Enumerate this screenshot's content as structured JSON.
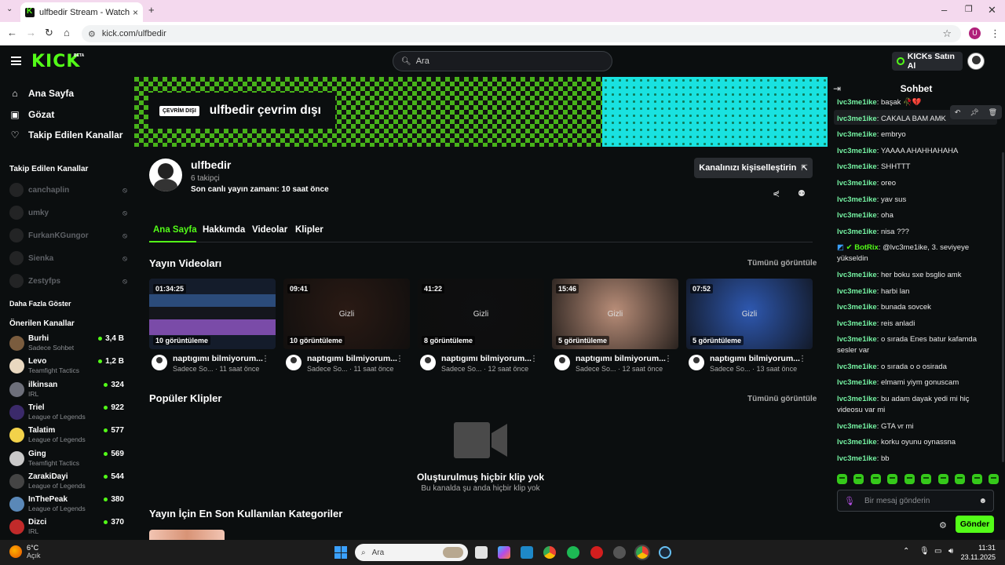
{
  "browser": {
    "tab_title": "ulfbedir Stream - Watch Live on Kick",
    "tab_close": "×",
    "new_tab": "+",
    "url": "kick.com/ulfbedir",
    "profile_initial": "U"
  },
  "header": {
    "logo": "KICK",
    "logo_badge": "BETA",
    "search_placeholder": "Ara",
    "kicks_button": "KICKs Satın Al"
  },
  "sidebar": {
    "nav": [
      {
        "label": "Ana Sayfa",
        "icon": "home-icon"
      },
      {
        "label": "Gözat",
        "icon": "browse-icon"
      },
      {
        "label": "Takip Edilen Kanallar",
        "icon": "heart-icon"
      }
    ],
    "followed_title": "Takip Edilen Kanallar",
    "followed": [
      {
        "name": "canchaplin"
      },
      {
        "name": "umky"
      },
      {
        "name": "FurkanKGungor"
      },
      {
        "name": "Sienka"
      },
      {
        "name": "Zestyfps"
      }
    ],
    "show_more": "Daha Fazla Göster",
    "recommended_title": "Önerilen Kanallar",
    "recommended": [
      {
        "name": "Burhi",
        "category": "Sadece Sohbet",
        "viewers": "3,4 B",
        "color": "#7a5c3e"
      },
      {
        "name": "Levo",
        "category": "Teamfight Tactics",
        "viewers": "1,2 B",
        "color": "#e9d8c0"
      },
      {
        "name": "ilkinsan",
        "category": "IRL",
        "viewers": "324",
        "color": "#6d6f7a"
      },
      {
        "name": "Triel",
        "category": "League of Legends",
        "viewers": "922",
        "color": "#3b2a6a"
      },
      {
        "name": "Talatim",
        "category": "League of Legends",
        "viewers": "577",
        "color": "#f2d24a"
      },
      {
        "name": "Ging",
        "category": "Teamfight Tactics",
        "viewers": "569",
        "color": "#c9c9c9"
      },
      {
        "name": "ZarakiDayi",
        "category": "League of Legends",
        "viewers": "544",
        "color": "#444"
      },
      {
        "name": "InThePeak",
        "category": "League of Legends",
        "viewers": "380",
        "color": "#5a88b8"
      },
      {
        "name": "Dizci",
        "category": "IRL",
        "viewers": "370",
        "color": "#c12a2a"
      }
    ]
  },
  "banner": {
    "tag": "ÇEVRİM DIŞI",
    "text": "ulfbedir çevrim dışı"
  },
  "channel": {
    "name": "ulfbedir",
    "followers": "6 takipçi",
    "last_live": "Son canlı yayın zamanı: 10 saat önce",
    "customize": "Kanalınızı kişiselleştirin"
  },
  "tabs": [
    "Ana Sayfa",
    "Hakkımda",
    "Videolar",
    "Klipler"
  ],
  "videos_section": {
    "title": "Yayın Videoları",
    "see_all": "Tümünü görüntüle",
    "items": [
      {
        "duration": "01:34:25",
        "views": "10 görüntüleme",
        "hidden": "",
        "title": "naptıgımı bilmiyorum...",
        "sub": "Sadece So... · 11 saat önce",
        "bg": "#22324a"
      },
      {
        "duration": "09:41",
        "views": "10 görüntüleme",
        "hidden": "Gizli",
        "title": "naptıgımı bilmiyorum...",
        "sub": "Sadece So... · 11 saat önce",
        "bg": "#2a1a14"
      },
      {
        "duration": "41:22",
        "views": "8 görüntüleme",
        "hidden": "Gizli",
        "title": "naptıgımı bilmiyorum...",
        "sub": "Sadece So... · 12 saat önce",
        "bg": "#0e0f10"
      },
      {
        "duration": "15:46",
        "views": "5 görüntüleme",
        "hidden": "Gizli",
        "title": "naptıgımı bilmiyorum...",
        "sub": "Sadece So... · 12 saat önce",
        "bg": "#b88d78"
      },
      {
        "duration": "07:52",
        "views": "5 görüntüleme",
        "hidden": "Gizli",
        "title": "naptıgımı bilmiyorum...",
        "sub": "Sadece So... · 13 saat önce",
        "bg": "#2e58b0"
      }
    ]
  },
  "clips_section": {
    "title": "Popüler Klipler",
    "see_all": "Tümünü görüntüle",
    "empty_title": "Oluşturulmuş hiçbir klip yok",
    "empty_sub": "Bu kanalda şu anda hiçbir klip yok"
  },
  "categories_section": {
    "title": "Yayın İçin En Son Kullanılan Kategoriler"
  },
  "chat": {
    "title": "Sohbet",
    "messages": [
      {
        "user": "lvc3me1ike",
        "text": "başak 🥀💔"
      },
      {
        "user": "lvc3me1ike",
        "text": "CAKALA BAM AMK"
      },
      {
        "user": "lvc3me1ike",
        "text": "embryo"
      },
      {
        "user": "lvc3me1ike",
        "text": "YAAAA AHAHHAHAHA"
      },
      {
        "user": "lvc3me1ike",
        "text": "SHHTTT"
      },
      {
        "user": "lvc3me1ike",
        "text": "oreo"
      },
      {
        "user": "lvc3me1ike",
        "text": "yav sus"
      },
      {
        "user": "lvc3me1ike",
        "text": "oha"
      },
      {
        "user": "lvc3me1ike",
        "text": "nisa ???"
      },
      {
        "user": "BotRix",
        "text": "@lvc3me1ike, 3. seviyeye yükseldin"
      },
      {
        "user": "lvc3me1ike",
        "text": "her boku sxe bsglio amk"
      },
      {
        "user": "lvc3me1ike",
        "text": "harbi lan"
      },
      {
        "user": "lvc3me1ike",
        "text": "bunada sovcek"
      },
      {
        "user": "lvc3me1ike",
        "text": "reis anladi"
      },
      {
        "user": "lvc3me1ike",
        "text": "o sırada Enes batur kafamda sesler var"
      },
      {
        "user": "lvc3me1ike",
        "text": "o sırada o o osirada"
      },
      {
        "user": "lvc3me1ike",
        "text": "elmami yiym gonuscam"
      },
      {
        "user": "lvc3me1ike",
        "text": "bu adam dayak yedi mi hiç videosu var mi"
      },
      {
        "user": "lvc3me1ike",
        "text": "GTA vr mi"
      },
      {
        "user": "lvc3me1ike",
        "text": "korku oyunu oynassna"
      },
      {
        "user": "lvc3me1ike",
        "text": "bb"
      }
    ],
    "input_placeholder": "Bir mesaj gönderin",
    "send": "Gönder"
  },
  "taskbar": {
    "temp": "6°C",
    "weather": "Açık",
    "search": "Ara",
    "time": "11:31",
    "date": "23.11.2025"
  }
}
